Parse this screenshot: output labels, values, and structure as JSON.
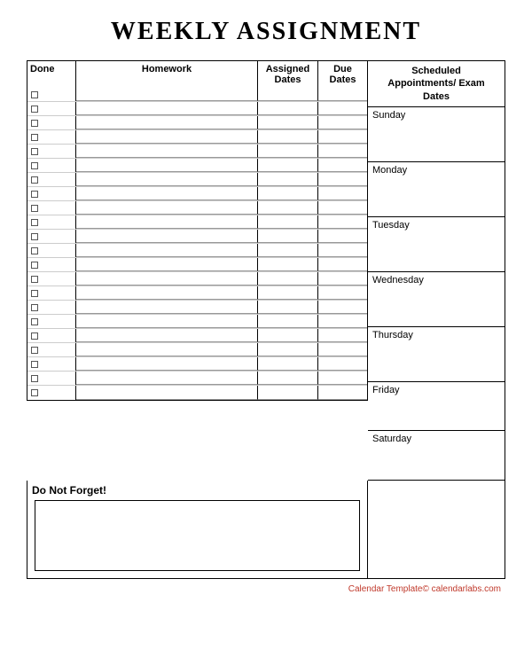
{
  "title": "WEEKLY ASSIGNMENT",
  "columns": {
    "done": "Done",
    "homework": "Homework",
    "assigned": "Assigned\nDates",
    "due": "Due\nDates"
  },
  "schedule": {
    "header": "Scheduled\nAppointments/ Exam\nDates",
    "days": [
      "Sunday",
      "Monday",
      "Tuesday",
      "Wednesday",
      "Thursday",
      "Friday",
      "Saturday"
    ]
  },
  "dont_forget": {
    "label": "Do Not Forget!",
    "placeholder": ""
  },
  "row_count": 22,
  "footer": "Calendar Template© calendarlabs.com"
}
